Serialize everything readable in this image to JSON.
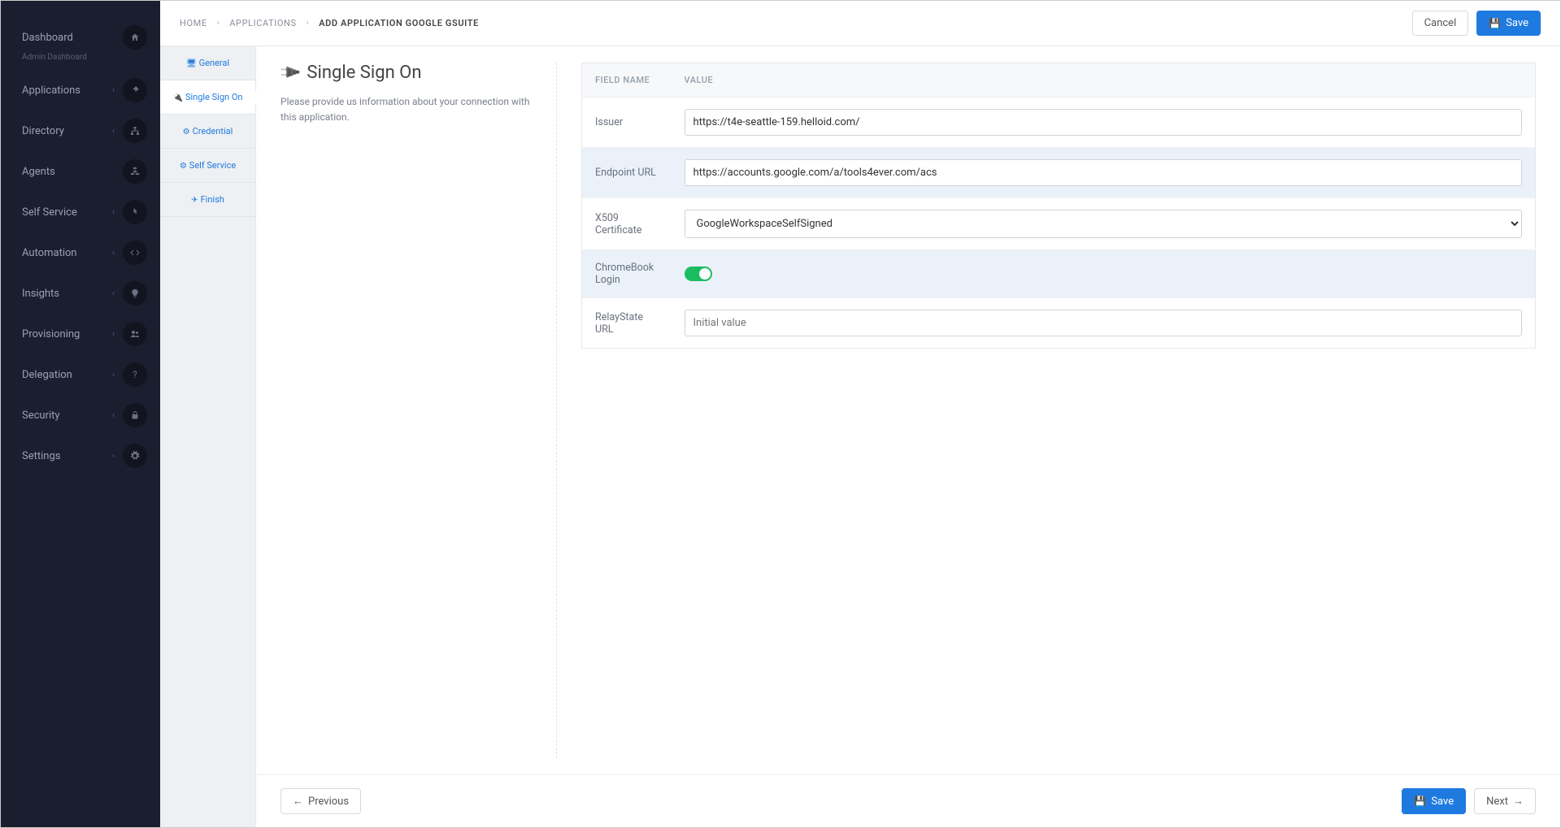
{
  "sidebar": {
    "items": [
      {
        "label": "Dashboard",
        "sub": "Admin Dashboard",
        "icon": "home",
        "hasChevron": false
      },
      {
        "label": "Applications",
        "sub": "",
        "icon": "pin",
        "hasChevron": true
      },
      {
        "label": "Directory",
        "sub": "",
        "icon": "sitemap",
        "hasChevron": true
      },
      {
        "label": "Agents",
        "sub": "",
        "icon": "cubes",
        "hasChevron": false
      },
      {
        "label": "Self Service",
        "sub": "",
        "icon": "pointer",
        "hasChevron": true
      },
      {
        "label": "Automation",
        "sub": "",
        "icon": "code",
        "hasChevron": true
      },
      {
        "label": "Insights",
        "sub": "",
        "icon": "bulb",
        "hasChevron": true
      },
      {
        "label": "Provisioning",
        "sub": "",
        "icon": "users",
        "hasChevron": true
      },
      {
        "label": "Delegation",
        "sub": "",
        "icon": "question",
        "hasChevron": true
      },
      {
        "label": "Security",
        "sub": "",
        "icon": "lock",
        "hasChevron": true
      },
      {
        "label": "Settings",
        "sub": "",
        "icon": "gear",
        "hasChevron": true
      }
    ]
  },
  "breadcrumb": {
    "home": "HOME",
    "applications": "APPLICATIONS",
    "current": "ADD APPLICATION GOOGLE GSUITE"
  },
  "topbar": {
    "cancel": "Cancel",
    "save": "Save"
  },
  "steps": [
    {
      "label": "General",
      "icon": "monitor"
    },
    {
      "label": "Single Sign On",
      "icon": "plug"
    },
    {
      "label": "Credential",
      "icon": "cogs"
    },
    {
      "label": "Self Service",
      "icon": "cogs"
    },
    {
      "label": "Finish",
      "icon": "plane"
    }
  ],
  "panel": {
    "title": "Single Sign On",
    "description": "Please provide us information about your connection with this application."
  },
  "table": {
    "header_field": "FIELD NAME",
    "header_value": "VALUE",
    "rows": {
      "issuer": {
        "label": "Issuer",
        "value": "https://t4e-seattle-159.helloid.com/"
      },
      "endpoint": {
        "label": "Endpoint URL",
        "value": "https://accounts.google.com/a/tools4ever.com/acs"
      },
      "cert": {
        "label": "X509 Certificate",
        "value": "GoogleWorkspaceSelfSigned"
      },
      "chromebook": {
        "label": "ChromeBook Login",
        "value": true
      },
      "relay": {
        "label": "RelayState URL",
        "value": "",
        "placeholder": "Initial value"
      }
    }
  },
  "footer": {
    "previous": "Previous",
    "save": "Save",
    "next": "Next"
  }
}
